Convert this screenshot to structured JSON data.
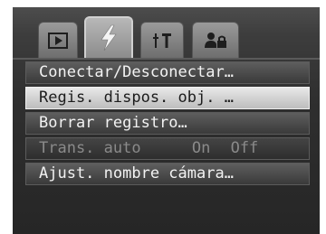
{
  "tabs": [
    {
      "icon": "play-icon",
      "active": false
    },
    {
      "icon": "lightning-icon",
      "active": true
    },
    {
      "icon": "tools-icon",
      "active": false
    },
    {
      "icon": "my-settings-icon",
      "active": false
    }
  ],
  "menu": {
    "items": [
      {
        "label": "Conectar/Desconectar…"
      },
      {
        "label": "Regis. dispos. obj. …"
      },
      {
        "label": "Borrar registro…"
      },
      {
        "label": "Trans. auto",
        "option_on": "On",
        "option_off": "Off"
      },
      {
        "label": "Ajust. nombre cámara…"
      }
    ],
    "selected_index": 1
  },
  "colors": {
    "selected_bg": "#d8d8d8",
    "item_bg": "#4a4a4a",
    "text": "#f2f2f2",
    "dim_text": "#8a8a8a"
  }
}
